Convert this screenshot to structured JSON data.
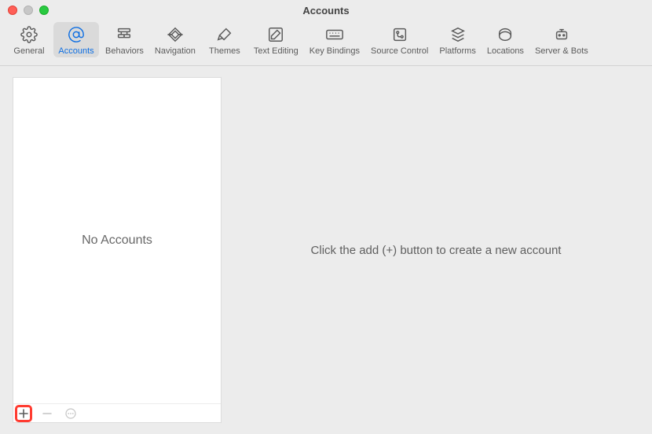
{
  "window": {
    "title": "Accounts"
  },
  "toolbar": {
    "items": [
      {
        "label": "General"
      },
      {
        "label": "Accounts"
      },
      {
        "label": "Behaviors"
      },
      {
        "label": "Navigation"
      },
      {
        "label": "Themes"
      },
      {
        "label": "Text Editing"
      },
      {
        "label": "Key Bindings"
      },
      {
        "label": "Source Control"
      },
      {
        "label": "Platforms"
      },
      {
        "label": "Locations"
      },
      {
        "label": "Server & Bots"
      }
    ],
    "selected_index": 1
  },
  "sidebar": {
    "empty_label": "No Accounts"
  },
  "main": {
    "hint": "Click the add (+) button to create a new account"
  }
}
